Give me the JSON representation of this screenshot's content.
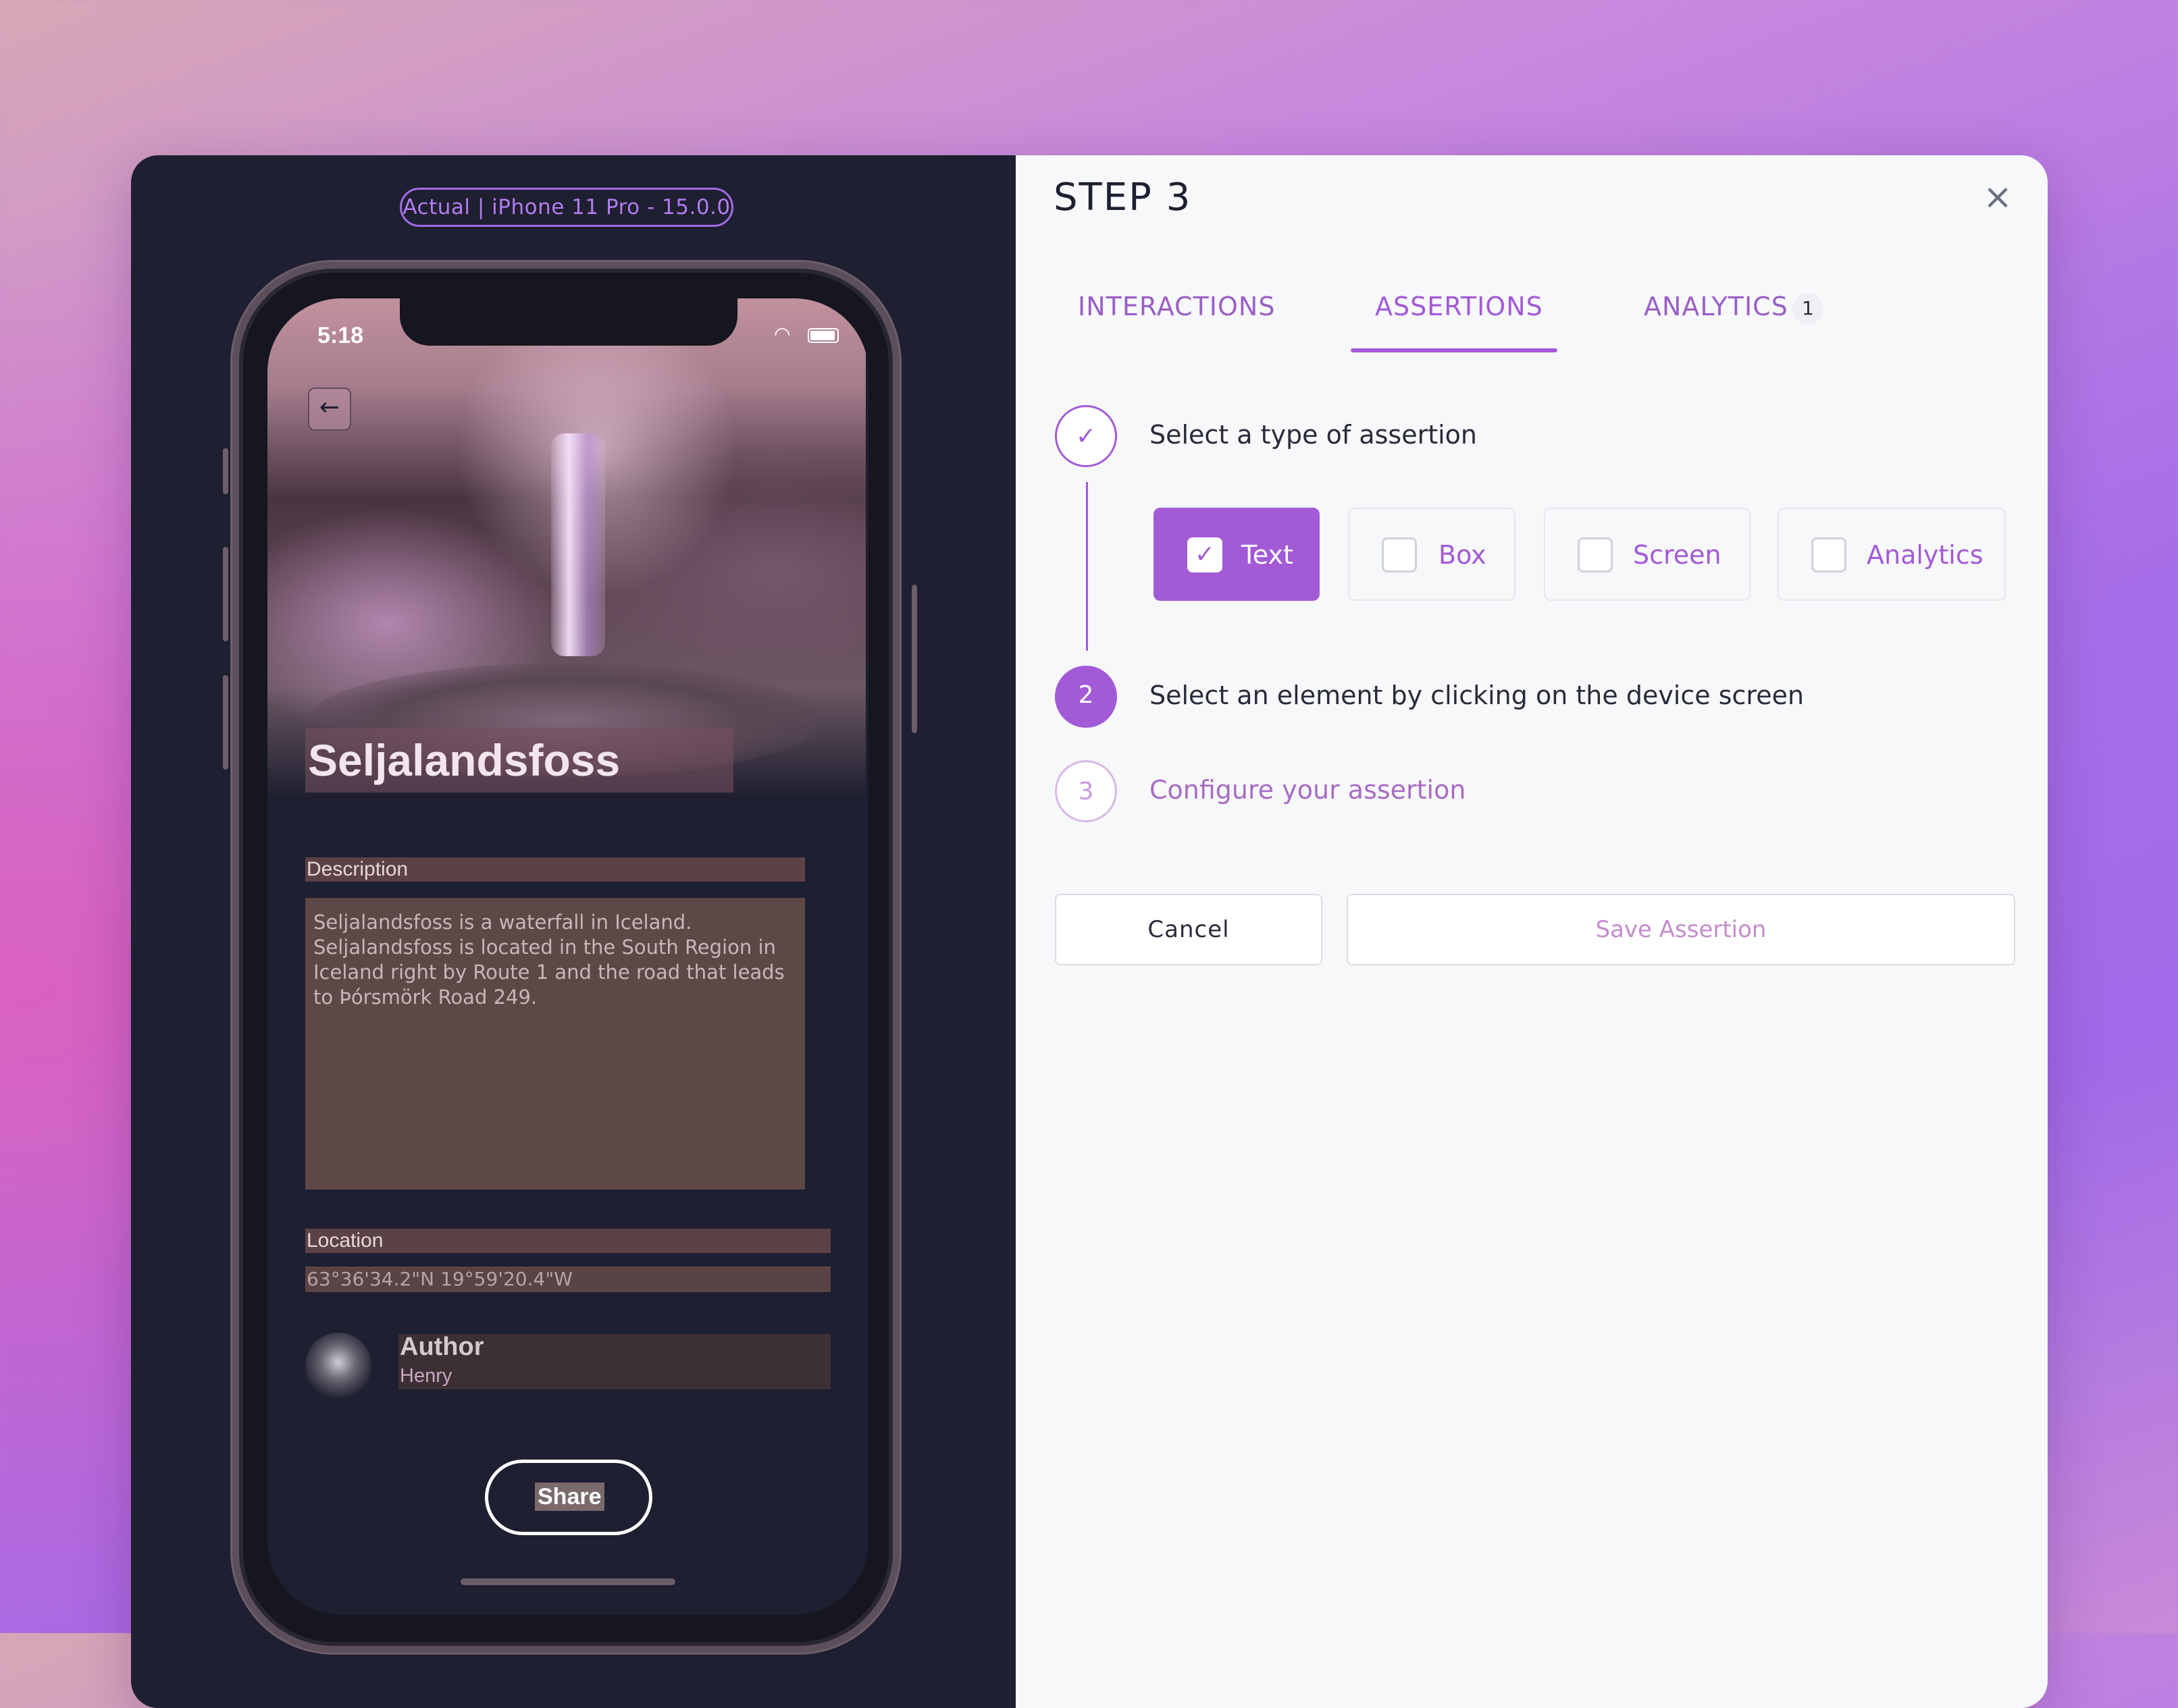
{
  "device": {
    "label": "Actual | iPhone 11 Pro - 15.0.0",
    "status_time": "5:18",
    "app": {
      "title": "Seljalandsfoss",
      "description_label": "Description",
      "description": "Seljalandsfoss is a waterfall in Iceland. Seljalandsfoss is located in the South Region in Iceland right by Route 1 and the road that leads to Þórsmörk Road 249.",
      "location_label": "Location",
      "location_value": "63°36'34.2\"N 19°59'20.4\"W",
      "author_label": "Author",
      "author_name": "Henry",
      "share_label": "Share"
    }
  },
  "panel": {
    "step_title": "STEP 3",
    "tabs": [
      {
        "label": "INTERACTIONS",
        "active": false
      },
      {
        "label": "ASSERTIONS",
        "active": true
      },
      {
        "label": "ANALYTICS",
        "active": false,
        "badge": "1"
      }
    ],
    "steps": [
      {
        "number": "✓",
        "text": "Select a type of assertion",
        "state": "done"
      },
      {
        "number": "2",
        "text": "Select an element by clicking on the device screen",
        "state": "current"
      },
      {
        "number": "3",
        "text": "Configure your assertion",
        "state": "pending"
      }
    ],
    "assertion_types": [
      {
        "label": "Text",
        "selected": true
      },
      {
        "label": "Box",
        "selected": false
      },
      {
        "label": "Screen",
        "selected": false
      },
      {
        "label": "Analytics",
        "selected": false
      }
    ],
    "buttons": {
      "cancel": "Cancel",
      "save": "Save Assertion"
    }
  },
  "colors": {
    "accent": "#a35ad7",
    "device_bg": "#1e1f30"
  }
}
